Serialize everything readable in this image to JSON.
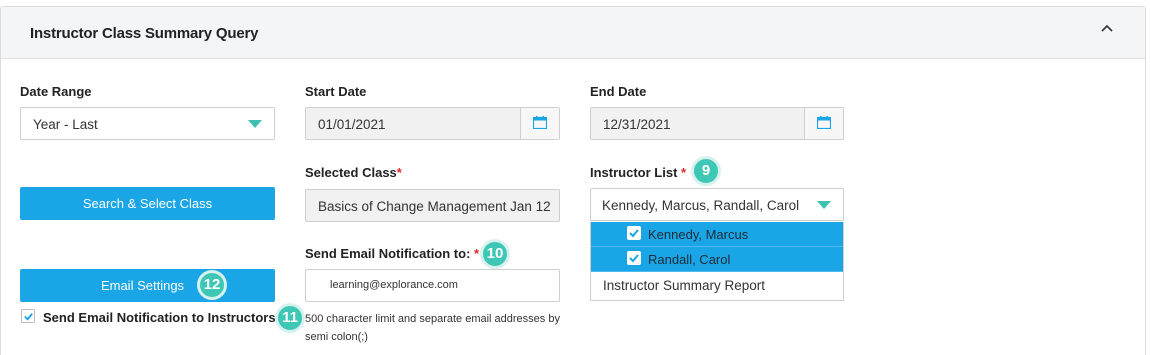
{
  "panel": {
    "title": "Instructor Class Summary Query"
  },
  "date_range": {
    "label": "Date Range",
    "value": "Year - Last"
  },
  "start_date": {
    "label": "Start Date",
    "value": "01/01/2021"
  },
  "end_date": {
    "label": "End Date",
    "value": "12/31/2021"
  },
  "selected_class": {
    "label": "Selected Class",
    "required_mark": "*",
    "value": "Basics of Change Management Jan 12"
  },
  "instructor_list": {
    "label": "Instructor List",
    "required_mark": "*",
    "value": "Kennedy, Marcus, Randall, Carol",
    "options": [
      {
        "label": "Kennedy, Marcus",
        "checked": true
      },
      {
        "label": "Randall, Carol",
        "checked": true
      }
    ],
    "extra_option": "Instructor Summary Report"
  },
  "email_notification": {
    "label": "Send Email Notification to:",
    "required_mark": "*",
    "value": "learning@explorance.com",
    "hint": "500 character limit and separate email addresses by semi colon(;)"
  },
  "buttons": {
    "search_select_class": "Search & Select Class",
    "email_settings": "Email Settings"
  },
  "send_to_instructors": {
    "label": "Send Email Notification to Instructors",
    "checked": true
  },
  "badges": {
    "instructor_list": "9",
    "email_notification": "10",
    "send_to_instructors": "11",
    "email_settings": "12"
  },
  "colors": {
    "accent_blue": "#1aa6e6",
    "badge_teal": "#3ec7b5",
    "caret_teal": "#3ec1b0",
    "required_red": "#e0262a"
  },
  "icons": {
    "collapse": "chevron-up-icon",
    "calendar": "calendar-icon",
    "dropdown": "caret-down-icon",
    "check": "check-icon"
  }
}
